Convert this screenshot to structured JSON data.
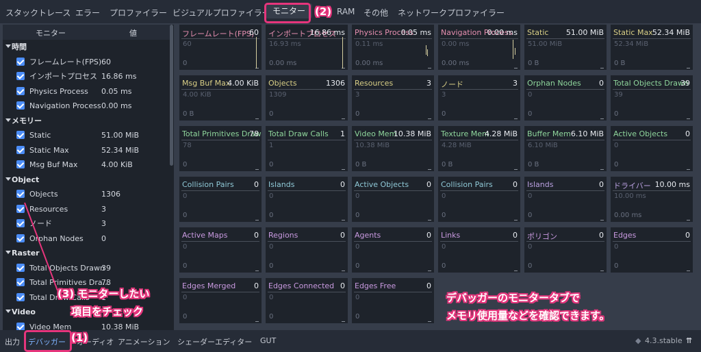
{
  "tabs": [
    "スタックトレース",
    "エラー",
    "プロファイラー",
    "ビジュアルプロファイラー",
    "モニター",
    "RAM",
    "その他",
    "ネットワークプロファイラー"
  ],
  "active_tab": "モニター",
  "sidebar": {
    "header_name": "モニター",
    "header_value": "値",
    "rows": [
      {
        "group": "時間"
      },
      {
        "label": "フレームレート(FPS)",
        "value": "60"
      },
      {
        "label": "インポートプロセス",
        "value": "16.86 ms"
      },
      {
        "label": "Physics Process",
        "value": "0.05 ms"
      },
      {
        "label": "Navigation Process",
        "value": "0.00 ms"
      },
      {
        "group": "メモリー"
      },
      {
        "label": "Static",
        "value": "51.00 MiB"
      },
      {
        "label": "Static Max",
        "value": "52.34 MiB"
      },
      {
        "label": "Msg Buf Max",
        "value": "4.00 KiB"
      },
      {
        "group": "Object"
      },
      {
        "label": "Objects",
        "value": "1306"
      },
      {
        "label": "Resources",
        "value": "3"
      },
      {
        "label": "ノード",
        "value": "3"
      },
      {
        "label": "Orphan Nodes",
        "value": "0"
      },
      {
        "group": "Raster"
      },
      {
        "label": "Total Objects Drawn",
        "value": "39"
      },
      {
        "label": "Total Primitives Dra...",
        "value": "78"
      },
      {
        "label": "Total Draw Calls",
        "value": "1"
      },
      {
        "group": "Video"
      },
      {
        "label": "Video Mem",
        "value": "10.38 MiB"
      }
    ]
  },
  "panels": [
    {
      "name": "フレームレート(FPS)",
      "value": "60",
      "max": "60",
      "min": "0",
      "color": "#e68fb0"
    },
    {
      "name": "インポートプロセス",
      "value": "16.86 ms",
      "max": "16.93 ms",
      "min": "0.00 ms",
      "color": "#e68fb0"
    },
    {
      "name": "Physics Process",
      "value": "0.05 ms",
      "max": "0.11 ms",
      "min": "0.00 ms",
      "color": "#e68fb0"
    },
    {
      "name": "Navigation Process",
      "value": "0.00 ms",
      "max": "0.00 ms",
      "min": "0.00 ms",
      "color": "#e68fb0"
    },
    {
      "name": "Static",
      "value": "51.00 MiB",
      "max": "51.00 MiB",
      "min": "0 B",
      "color": "#d9cf86"
    },
    {
      "name": "Static Max",
      "value": "52.34 MiB",
      "max": "52.34 MiB",
      "min": "0 B",
      "color": "#d9cf86"
    },
    {
      "name": "Msg Buf Max",
      "value": "4.00 KiB",
      "max": "4.00 KiB",
      "min": "0 B",
      "color": "#d9cf86"
    },
    {
      "name": "Objects",
      "value": "1306",
      "max": "1309",
      "min": "0",
      "color": "#d9cf86"
    },
    {
      "name": "Resources",
      "value": "3",
      "max": "3",
      "min": "0",
      "color": "#d9cf86"
    },
    {
      "name": "ノード",
      "value": "3",
      "max": "3",
      "min": "0",
      "color": "#d9cf86"
    },
    {
      "name": "Orphan Nodes",
      "value": "0",
      "max": "0",
      "min": "0",
      "color": "#8fd69c"
    },
    {
      "name": "Total Objects Drawn",
      "value": "39",
      "max": "39",
      "min": "0",
      "color": "#8fd69c"
    },
    {
      "name": "Total Primitives Drawn",
      "value": "78",
      "max": "78",
      "min": "0",
      "color": "#8fd69c"
    },
    {
      "name": "Total Draw Calls",
      "value": "1",
      "max": "1",
      "min": "0",
      "color": "#8fd69c"
    },
    {
      "name": "Video Mem",
      "value": "10.38 MiB",
      "max": "10.38 MiB",
      "min": "0 B",
      "color": "#8fd69c"
    },
    {
      "name": "Texture Mem",
      "value": "4.28 MiB",
      "max": "4.28 MiB",
      "min": "0 B",
      "color": "#8fd69c"
    },
    {
      "name": "Buffer Mem",
      "value": "6.10 MiB",
      "max": "6.10 MiB",
      "min": "0 B",
      "color": "#8fd69c"
    },
    {
      "name": "Active Objects",
      "value": "0",
      "max": "0",
      "min": "0",
      "color": "#8fd69c"
    },
    {
      "name": "Collision Pairs",
      "value": "0",
      "max": "0",
      "min": "0",
      "color": "#8fc8d6"
    },
    {
      "name": "Islands",
      "value": "0",
      "max": "0",
      "min": "0",
      "color": "#8fc8d6"
    },
    {
      "name": "Active Objects",
      "value": "0",
      "max": "0",
      "min": "0",
      "color": "#8fc8d6"
    },
    {
      "name": "Collision Pairs",
      "value": "0",
      "max": "0",
      "min": "0",
      "color": "#8fc8d6"
    },
    {
      "name": "Islands",
      "value": "0",
      "max": "0",
      "min": "0",
      "color": "#b9a0e0"
    },
    {
      "name": "ドライバー",
      "value": "10.00 ms",
      "max": "10.00 ms",
      "min": "0.00 ms",
      "color": "#b9a0e0"
    },
    {
      "name": "Active Maps",
      "value": "0",
      "max": "0",
      "min": "0",
      "color": "#c99ae0"
    },
    {
      "name": "Regions",
      "value": "0",
      "max": "0",
      "min": "0",
      "color": "#c99ae0"
    },
    {
      "name": "Agents",
      "value": "0",
      "max": "0",
      "min": "0",
      "color": "#c99ae0"
    },
    {
      "name": "Links",
      "value": "0",
      "max": "0",
      "min": "0",
      "color": "#c99ae0"
    },
    {
      "name": "ポリゴン",
      "value": "0",
      "max": "0",
      "min": "0",
      "color": "#c99ae0"
    },
    {
      "name": "Edges",
      "value": "0",
      "max": "0",
      "min": "0",
      "color": "#c99ae0"
    },
    {
      "name": "Edges Merged",
      "value": "0",
      "max": "0",
      "min": "0",
      "color": "#c99ae0"
    },
    {
      "name": "Edges Connected",
      "value": "0",
      "max": "0",
      "min": "0",
      "color": "#c99ae0"
    },
    {
      "name": "Edges Free",
      "value": "0",
      "max": "0",
      "min": "0",
      "color": "#c99ae0"
    }
  ],
  "bottom": {
    "tabs": [
      "出力",
      "デバッガー",
      "オーディオ",
      "アニメーション",
      "シェーダーエディター",
      "GUT"
    ],
    "version": "4.3.stable"
  },
  "annotations": {
    "step1": "(1)",
    "step2": "(2)",
    "step3_line1": "(3) モニターしたい",
    "step3_line2": "項目をチェック",
    "note_line1": "デバッガーのモニタータブで",
    "note_line2": "メモリ使用量などを確認できます。",
    "color": "#e6357c"
  }
}
